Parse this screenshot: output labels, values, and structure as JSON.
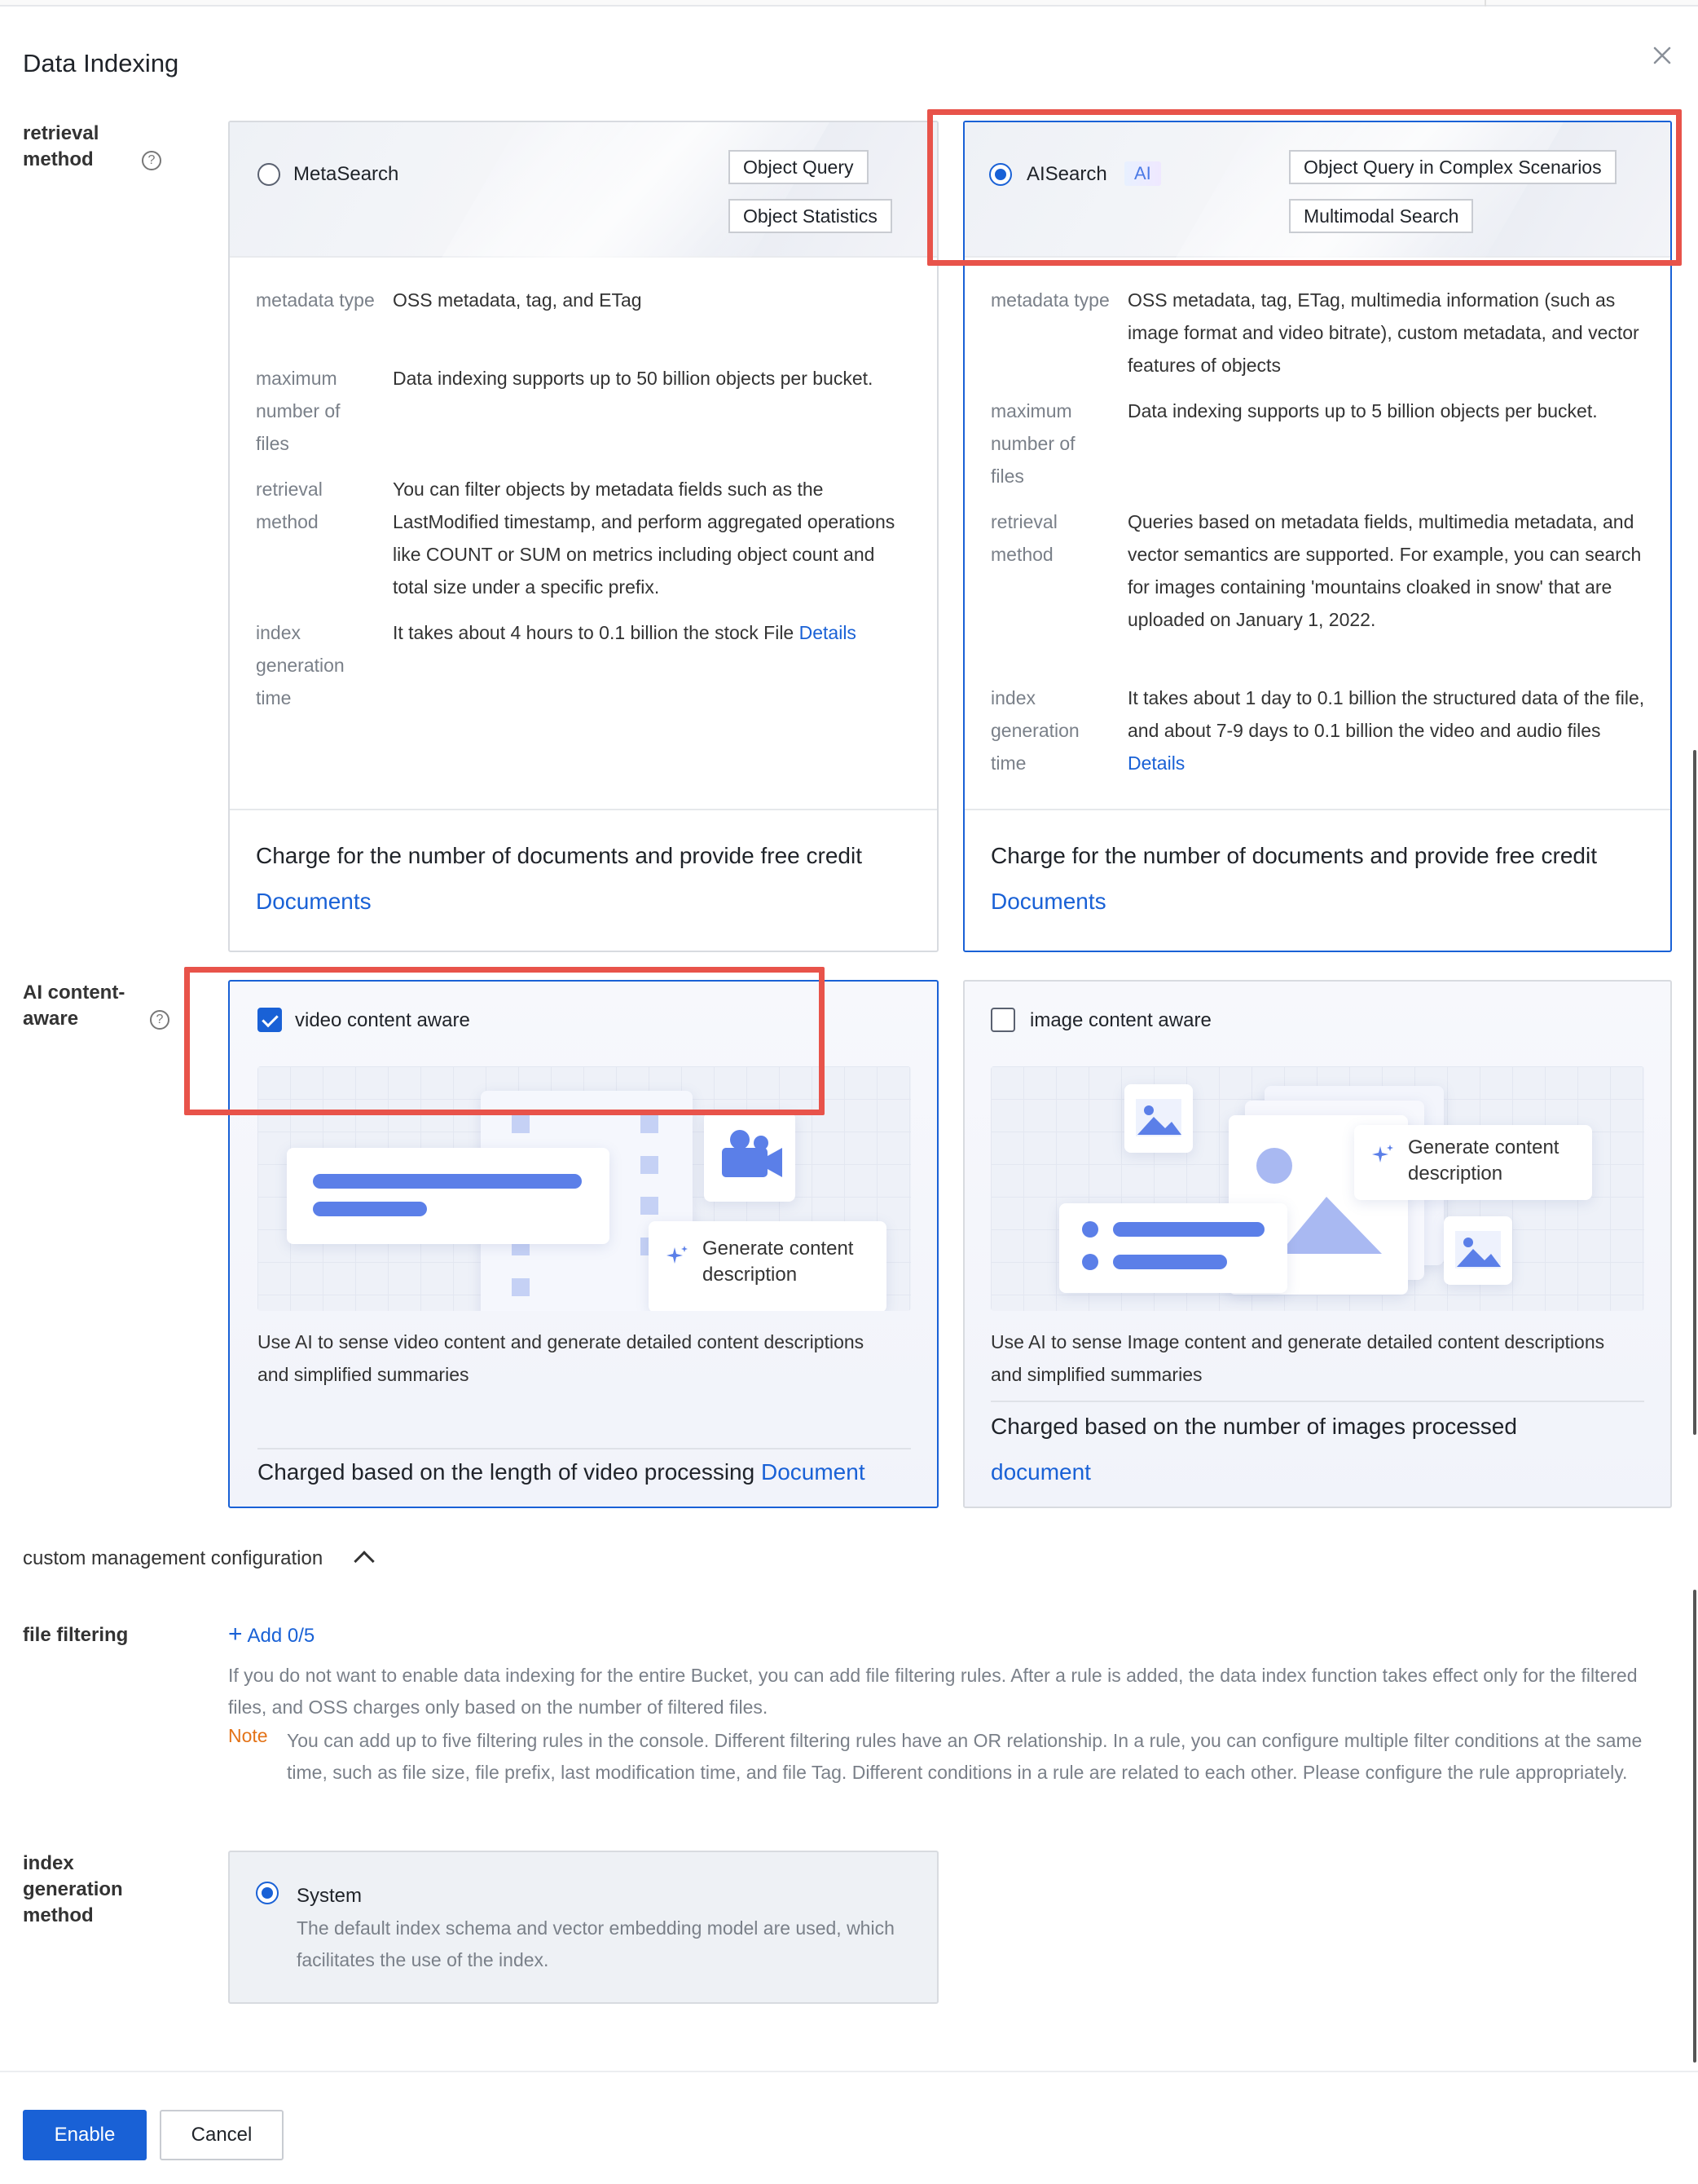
{
  "dialog": {
    "title": "Data Indexing"
  },
  "retrieval": {
    "label": "retrieval method",
    "help": "?",
    "meta_search": {
      "name": "MetaSearch",
      "selected": false,
      "tags": [
        "Object Query",
        "Object Statistics"
      ],
      "metadata_type_k": "metadata type",
      "metadata_type_v": "OSS metadata, tag, and ETag",
      "max_files_k": "maximum number of files",
      "max_files_v": "Data indexing supports up to 50 billion objects per bucket.",
      "method_k": "retrieval method",
      "method_v": "You can filter objects by metadata fields such as the LastModified timestamp, and perform aggregated operations like COUNT or SUM on metrics including object count and total size under a specific prefix.",
      "time_k": "index generation time",
      "time_v": "It takes about 4 hours to 0.1 billion the stock File",
      "time_link": "Details",
      "charge": "Charge for the number of documents and provide free credit",
      "doc_link": "Documents"
    },
    "ai_search": {
      "name": "AISearch",
      "badge": "AI",
      "selected": true,
      "tags": [
        "Object Query in Complex Scenarios",
        "Multimodal Search"
      ],
      "metadata_type_k": "metadata type",
      "metadata_type_v": "OSS metadata, tag, ETag, multimedia information (such as image format and video bitrate), custom metadata, and vector features of objects",
      "max_files_k": "maximum number of files",
      "max_files_v": "Data indexing supports up to 5 billion objects per bucket.",
      "method_k": "retrieval method",
      "method_v": "Queries based on metadata fields, multimedia metadata, and vector semantics are supported. For example, you can search for images containing 'mountains cloaked in snow' that are uploaded on January 1, 2022.",
      "time_k": "index generation time",
      "time_v": "It takes about 1 day to 0.1 billion the structured data of the file, and about 7-9 days to 0.1 billion the video and audio files",
      "time_link": "Details",
      "charge": "Charge for the number of documents and provide free credit",
      "doc_link": "Documents"
    }
  },
  "ai_content": {
    "label": "AI content-aware",
    "help": "?",
    "video": {
      "name": "video content aware",
      "checked": true,
      "gen_text": "Generate content description",
      "desc": "Use AI to sense video content and generate detailed content descriptions and simplified summaries",
      "charge": "Charged based on the length of video processing",
      "doc_link": "Document"
    },
    "image": {
      "name": "image content aware",
      "checked": false,
      "gen_text": "Generate content description",
      "desc": "Use AI to sense Image content and generate detailed content descriptions and simplified summaries",
      "charge": "Charged based on the number of images processed",
      "doc_link": "document"
    }
  },
  "custom": {
    "toggle_label": "custom management configuration",
    "expanded": true
  },
  "file_filtering": {
    "label": "file filtering",
    "add_label": "Add 0/5",
    "para": "If you do not want to enable data indexing for the entire Bucket, you can add file filtering rules. After a rule is added, the data index function takes effect only for the filtered files, and OSS charges only based on the number of filtered files.",
    "note_k": "Note",
    "note_v": "You can add up to five filtering rules in the console. Different filtering rules have an OR relationship. In a rule, you can configure multiple filter conditions at the same time, such as file size, file prefix, last modification time, and file Tag. Different conditions in a rule are related to each other. Please configure the rule appropriately."
  },
  "index_method": {
    "label": "index generation method",
    "option": "System",
    "selected": true,
    "desc": "The default index schema and vector embedding model are used, which facilitates the use of the index."
  },
  "footer": {
    "enable": "Enable",
    "cancel": "Cancel"
  },
  "colors": {
    "primary": "#1961d6",
    "highlight": "#e8534a",
    "warning_text": "#a0780b",
    "note": "#e37318"
  }
}
